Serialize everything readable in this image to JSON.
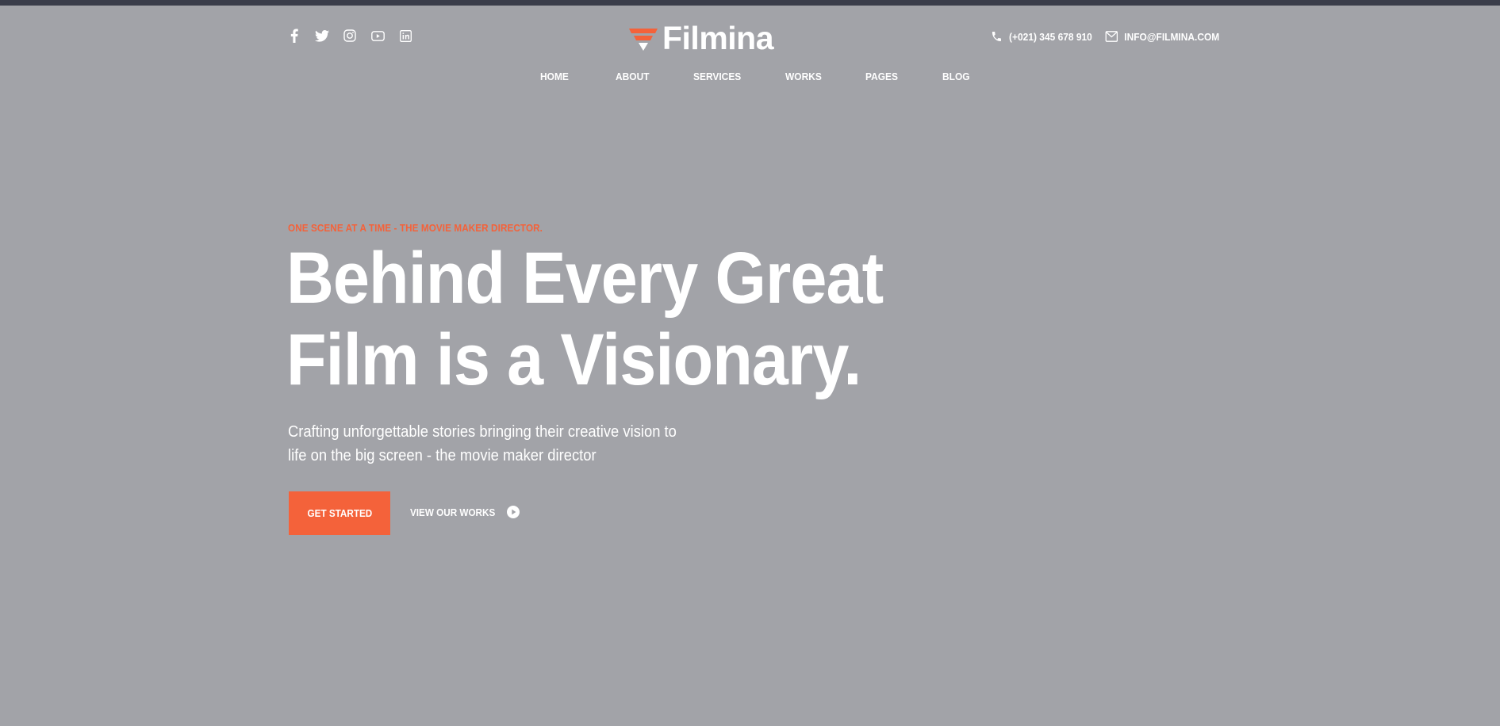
{
  "colors": {
    "accent": "#f4623a",
    "background": "#a2a3a8",
    "top_bar": "#3a3d4a",
    "text": "#ffffff"
  },
  "social": [
    {
      "icon": "facebook-icon"
    },
    {
      "icon": "twitter-icon"
    },
    {
      "icon": "instagram-icon"
    },
    {
      "icon": "youtube-icon"
    },
    {
      "icon": "linkedin-icon"
    }
  ],
  "brand": {
    "name": "Filmina",
    "icon": "filmina-logo-icon"
  },
  "contact": {
    "phone": "(+021) 345 678 910",
    "phone_icon": "phone-icon",
    "email": "INFO@FILMINA.COM",
    "email_icon": "mail-icon"
  },
  "nav": {
    "items": [
      {
        "label": "HOME"
      },
      {
        "label": "ABOUT"
      },
      {
        "label": "SERVICES"
      },
      {
        "label": "WORKS"
      },
      {
        "label": "PAGES"
      },
      {
        "label": "BLOG"
      }
    ]
  },
  "hero": {
    "eyebrow": "ONE SCENE AT A TIME - THE MOVIE MAKER DIRECTOR.",
    "headline_line1": "Behind Every Great",
    "headline_line2": "Film is a Visionary.",
    "lede_line1": "Crafting unforgettable stories bringing their creative vision to",
    "lede_line2": "life on the big screen - the movie maker director",
    "primary_cta": "GET STARTED",
    "secondary_cta": "VIEW OUR WORKS",
    "secondary_icon": "play-circle-icon"
  }
}
